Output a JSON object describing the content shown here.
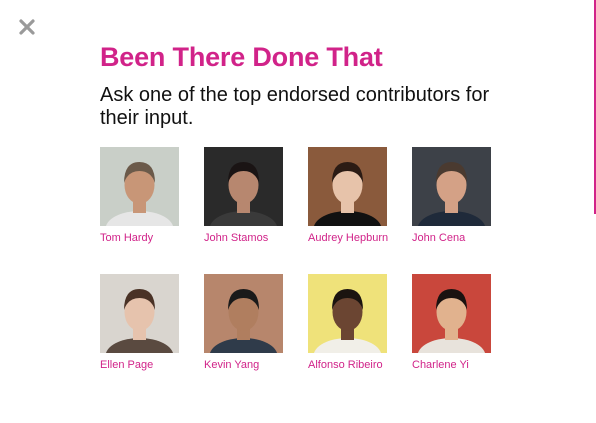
{
  "modal": {
    "title": "Been There Done That",
    "subtitle": "Ask one of the top endorsed contributors for their input.",
    "close_icon": "close-icon"
  },
  "colors": {
    "accent": "#d12389",
    "text": "#111111",
    "close": "#9a9a9a"
  },
  "contributors": [
    {
      "name": "Tom Hardy",
      "bg": "#c9cfc8",
      "skin": "#c89677",
      "hair": "#6b5a4a",
      "shirt": "#e6e6e6"
    },
    {
      "name": "John Stamos",
      "bg": "#2a2a2a",
      "skin": "#b7876f",
      "hair": "#1a1414",
      "shirt": "#3a3a3a"
    },
    {
      "name": "Audrey Hepburn",
      "bg": "#8a5a3c",
      "skin": "#e7c3aa",
      "hair": "#2b1b14",
      "shirt": "#111111"
    },
    {
      "name": "John Cena",
      "bg": "#3d4148",
      "skin": "#d4a186",
      "hair": "#4a3a30",
      "shirt": "#1f2a3a"
    },
    {
      "name": "Ellen Page",
      "bg": "#d9d5cf",
      "skin": "#e6c3ad",
      "hair": "#4a3226",
      "shirt": "#5a4a40"
    },
    {
      "name": "Kevin Yang",
      "bg": "#b7866c",
      "skin": "#b07e5f",
      "hair": "#1a1a1a",
      "shirt": "#2f3b4a"
    },
    {
      "name": "Alfonso Ribeiro",
      "bg": "#efe27a",
      "skin": "#6b4532",
      "hair": "#1b1410",
      "shirt": "#f1efe8"
    },
    {
      "name": "Charlene Yi",
      "bg": "#c9473c",
      "skin": "#e1b28e",
      "hair": "#1a1210",
      "shirt": "#e8e3dc"
    }
  ]
}
